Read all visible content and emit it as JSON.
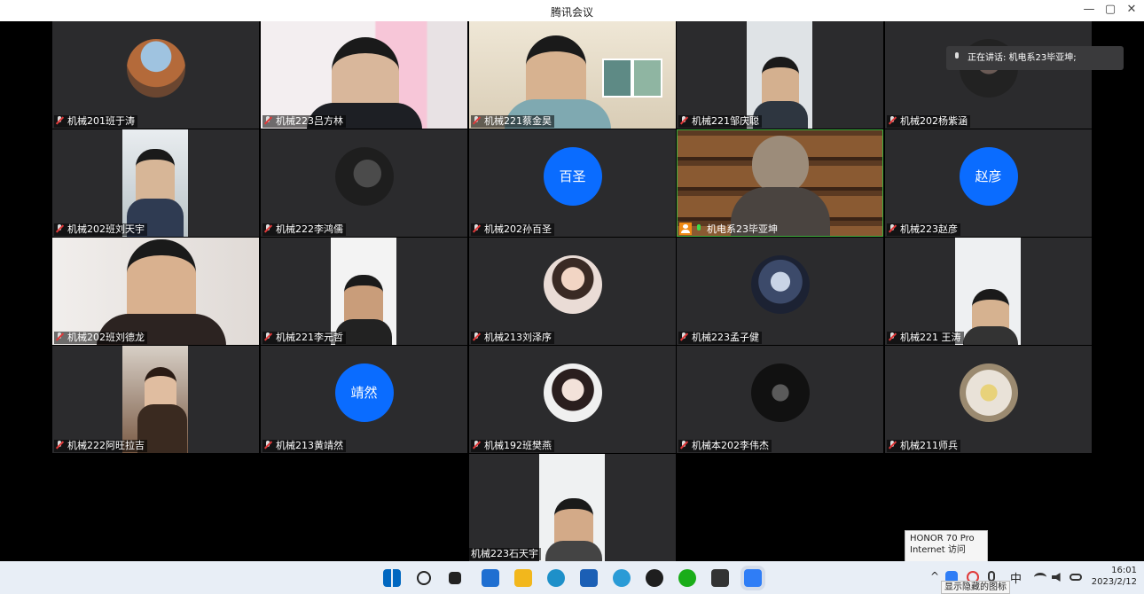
{
  "window": {
    "title": "腾讯会议",
    "minimize": "—",
    "maximize": "▢",
    "close": "✕"
  },
  "speaking_banner": {
    "text": "正在讲话: 机电系23毕亚坤;"
  },
  "participants": [
    {
      "name": "机械201班于涛",
      "kind": "avatar-image",
      "mic": "muted"
    },
    {
      "name": "机械223吕方林",
      "kind": "video",
      "mic": "muted"
    },
    {
      "name": "机械221蔡金昊",
      "kind": "video",
      "mic": "muted"
    },
    {
      "name": "机械221邹庆聪",
      "kind": "video",
      "mic": "muted"
    },
    {
      "name": "机械202杨紫涵",
      "kind": "avatar-image",
      "mic": "muted"
    },
    {
      "name": "机械202班刘天宇",
      "kind": "video",
      "mic": "muted"
    },
    {
      "name": "机械222李鸿儒",
      "kind": "avatar-image",
      "mic": "muted"
    },
    {
      "name": "机械202孙百圣",
      "kind": "avatar-text",
      "avatar_text": "百圣",
      "mic": "muted"
    },
    {
      "name": "机电系23毕亚坤",
      "kind": "video",
      "mic": "on",
      "host": true
    },
    {
      "name": "机械223赵彦",
      "kind": "avatar-text",
      "avatar_text": "赵彦",
      "mic": "muted"
    },
    {
      "name": "机械202班刘德龙",
      "kind": "video",
      "mic": "muted"
    },
    {
      "name": "机械221李元哲",
      "kind": "video",
      "mic": "muted"
    },
    {
      "name": "机械213刘泽序",
      "kind": "avatar-image",
      "mic": "muted"
    },
    {
      "name": "机械223孟子健",
      "kind": "avatar-image",
      "mic": "muted"
    },
    {
      "name": "机械221 王涛",
      "kind": "video",
      "mic": "muted"
    },
    {
      "name": "机械222阿旺拉吉",
      "kind": "video",
      "mic": "muted"
    },
    {
      "name": "机械213黄靖然",
      "kind": "avatar-text",
      "avatar_text": "靖然",
      "mic": "muted"
    },
    {
      "name": "机械192班樊燕",
      "kind": "avatar-image",
      "mic": "muted"
    },
    {
      "name": "机械本202李伟杰",
      "kind": "avatar-image",
      "mic": "muted"
    },
    {
      "name": "机械211师兵",
      "kind": "avatar-image",
      "mic": "muted"
    },
    {
      "name": "机械223石天宇",
      "kind": "video",
      "mic": "none"
    }
  ],
  "taskbar": {
    "icons": [
      "windows-start-icon",
      "search-icon",
      "task-view-icon",
      "widgets-icon",
      "file-explorer-icon",
      "edge-icon",
      "store-icon",
      "browser-icon",
      "xbox-icon",
      "wechat-icon",
      "app-icon",
      "tencent-meeting-icon"
    ],
    "tray": {
      "chevron": "^",
      "ime": "中",
      "time": "16:01",
      "date": "2023/2/12"
    }
  },
  "notification": {
    "line1": "HONOR 70 Pro",
    "line2": "Internet 访问"
  },
  "tray_tooltip": "显示隐藏的图标"
}
